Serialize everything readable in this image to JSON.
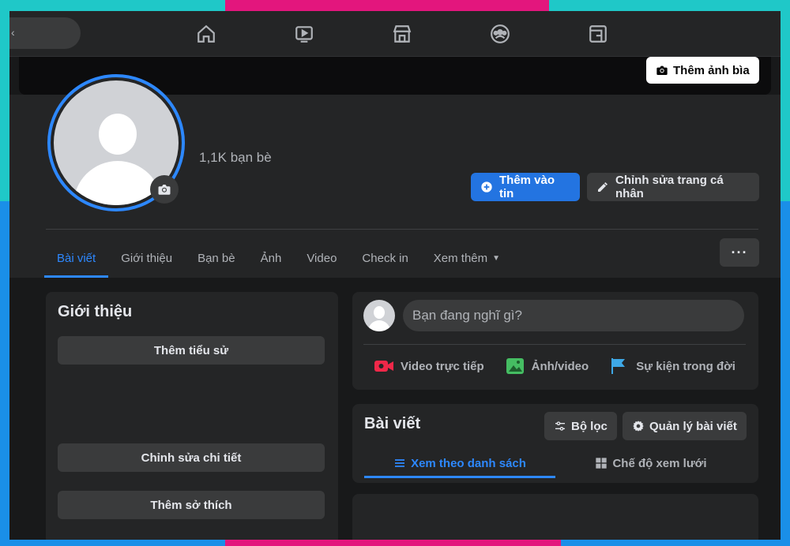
{
  "colors": {
    "accent": "#2d88ff",
    "primary_button": "#2374e1",
    "bg": "#18191a",
    "card": "#242526"
  },
  "topnav": {
    "icons": [
      "home-icon",
      "watch-icon",
      "marketplace-icon",
      "groups-icon",
      "gaming-icon"
    ]
  },
  "cover": {
    "add_cover_label": "Thêm ảnh bìa"
  },
  "profile": {
    "friends_count": "1,1K bạn bè",
    "add_story_label": "Thêm vào tin",
    "edit_profile_label": "Chỉnh sửa trang cá nhân"
  },
  "tabs": [
    {
      "label": "Bài viết",
      "active": true
    },
    {
      "label": "Giới thiệu"
    },
    {
      "label": "Bạn bè"
    },
    {
      "label": "Ảnh"
    },
    {
      "label": "Video"
    },
    {
      "label": "Check in"
    },
    {
      "label": "Xem thêm"
    }
  ],
  "more_menu_label": "···",
  "intro": {
    "title": "Giới thiệu",
    "add_bio": "Thêm tiểu sử",
    "edit_details": "Chỉnh sửa chi tiết",
    "add_hobbies": "Thêm sở thích"
  },
  "composer": {
    "placeholder": "Bạn đang nghĩ gì?",
    "live_video": "Video trực tiếp",
    "photo_video": "Ảnh/video",
    "life_event": "Sự kiện trong đời"
  },
  "posts": {
    "title": "Bài viết",
    "filter_label": "Bộ lọc",
    "manage_label": "Quản lý bài viết",
    "list_view": "Xem theo danh sách",
    "grid_view": "Chế độ xem lưới"
  }
}
